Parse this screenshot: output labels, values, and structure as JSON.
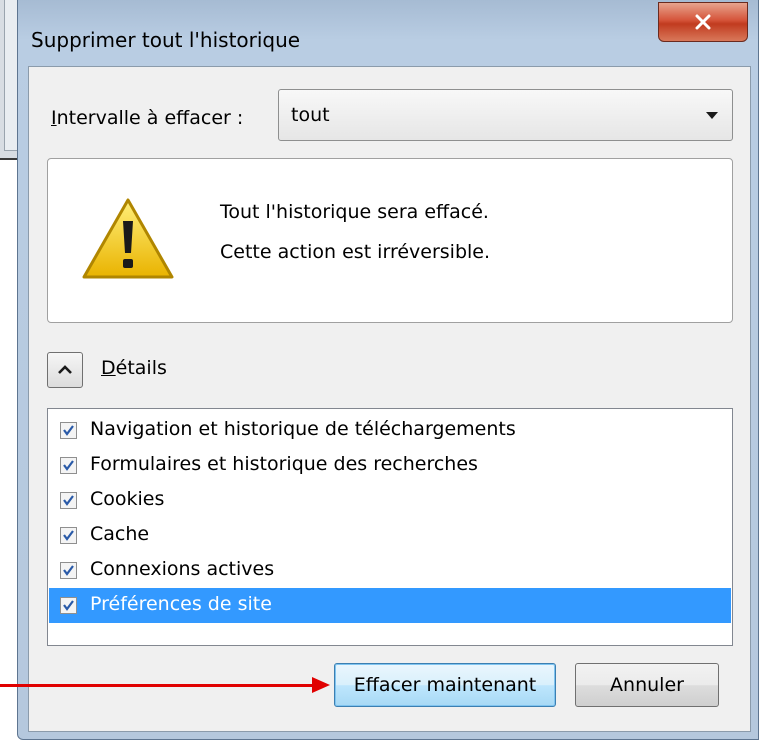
{
  "dialog": {
    "title": "Supprimer tout l'historique",
    "close_label": "x"
  },
  "range": {
    "label_accel": "I",
    "label_rest": "ntervalle à effacer :",
    "selected": "tout"
  },
  "warning": {
    "icon": "warning-icon",
    "line1": "Tout l'historique sera effacé.",
    "line2": "Cette action est irréversible."
  },
  "details": {
    "toggle_icon": "chevron-up-icon",
    "label_accel": "D",
    "label_rest": "étails"
  },
  "items": [
    {
      "label": "Navigation et historique de téléchargements",
      "checked": true,
      "selected": false
    },
    {
      "label": "Formulaires et historique des recherches",
      "checked": true,
      "selected": false
    },
    {
      "label": "Cookies",
      "checked": true,
      "selected": false
    },
    {
      "label": "Cache",
      "checked": true,
      "selected": false
    },
    {
      "label": "Connexions actives",
      "checked": true,
      "selected": false
    },
    {
      "label": "Préférences de site",
      "checked": true,
      "selected": true
    }
  ],
  "buttons": {
    "clear_now": "Effacer maintenant",
    "cancel": "Annuler"
  },
  "colors": {
    "selection": "#3399ff",
    "annotation_arrow": "#e00000"
  }
}
